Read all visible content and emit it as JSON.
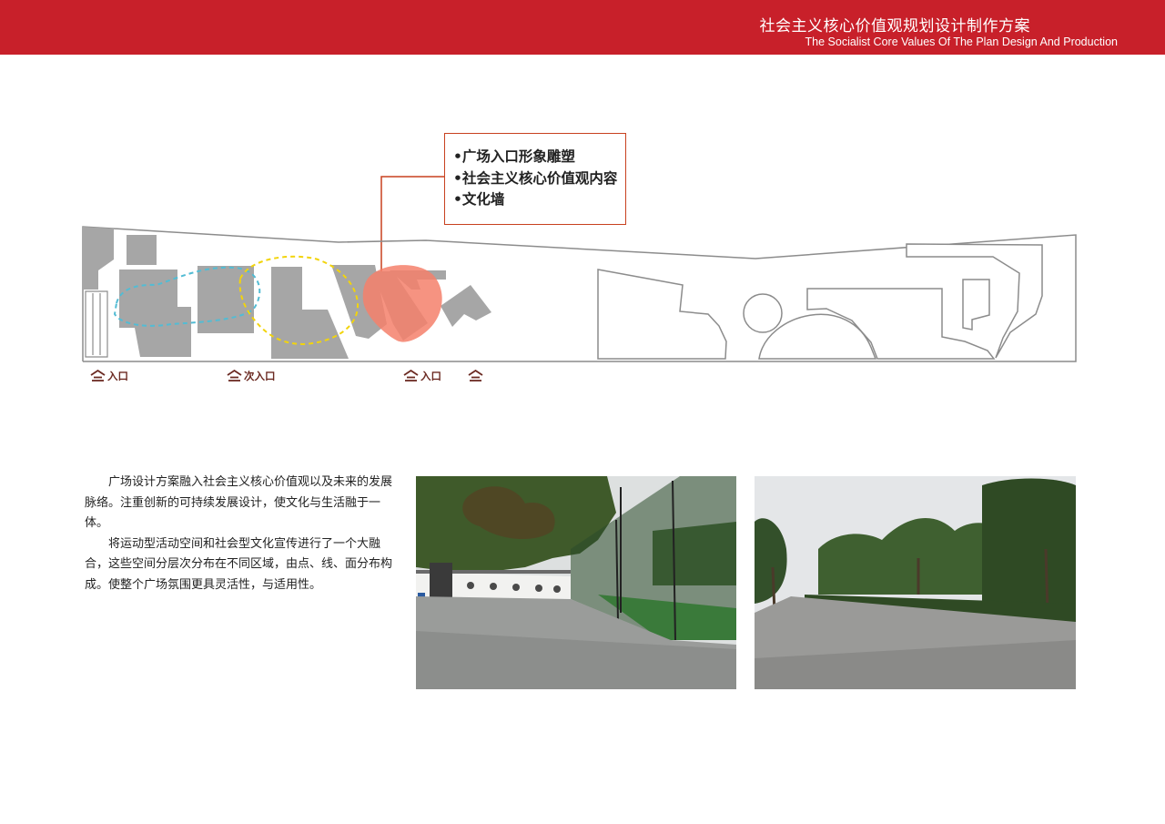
{
  "header": {
    "title_cn": "社会主义核心价值观规划设计制作方案",
    "title_en": "The Socialist Core Values Of The Plan Design And Production",
    "color": "#c8202a"
  },
  "callout": {
    "items": [
      "•广场入口形象雕塑",
      "•社会主义核心价值观内容",
      "•文化墙"
    ],
    "border_color": "#c8411f"
  },
  "entrances": [
    "入口",
    "次入口",
    "入口",
    ""
  ],
  "description": {
    "paragraphs": [
      "广场设计方案融入社会主义核心价值观以及未来的发展脉络。注重创新的可持续发展设计，使文化与生活融于一体。",
      "将运动型活动空间和社会型文化宣传进行了一个大融合，这些空间分层次分布在不同区域，由点、线、面分布构成。使整个广场氛围更具灵活性，与适用性。"
    ]
  },
  "colors": {
    "building_fill": "#a6a6a6",
    "outline": "#8c8c8c",
    "blue_dash": "#52bcd4",
    "yellow_dash": "#f2d40c",
    "highlight": "#f5806b",
    "entrance_icon": "#6b2a22"
  },
  "icons": {
    "entrance": "entrance-icon"
  }
}
